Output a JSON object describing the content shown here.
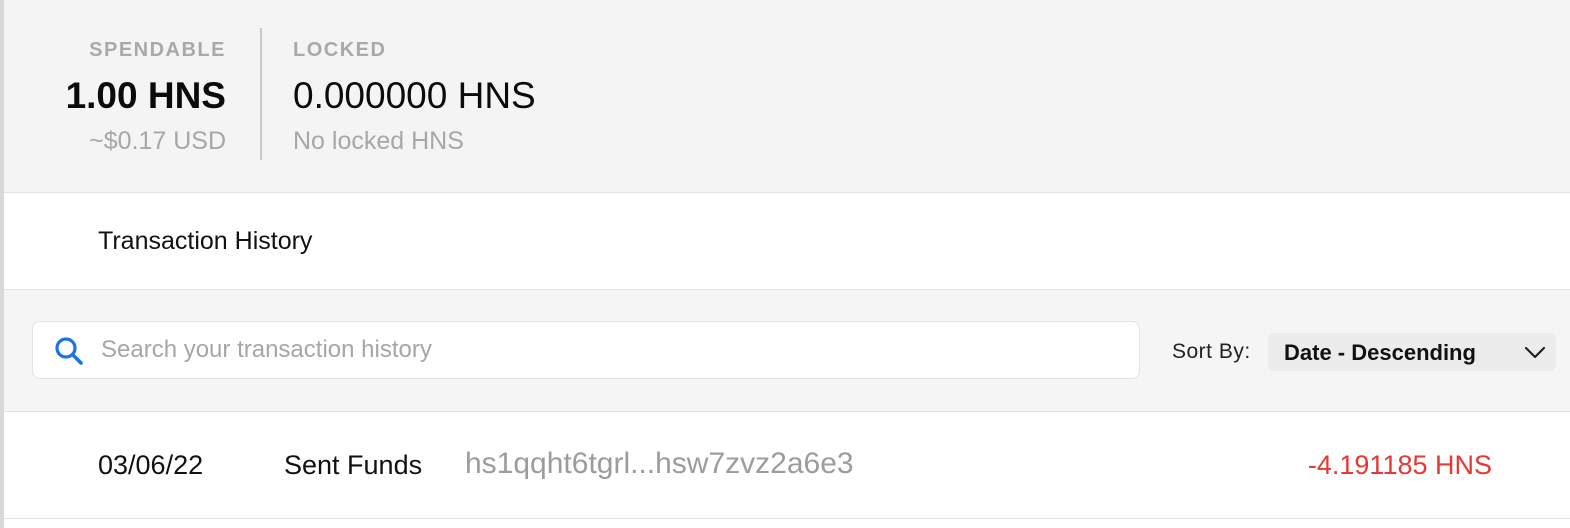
{
  "balances": {
    "spendable": {
      "label": "SPENDABLE",
      "amount": "1.00 HNS",
      "usd": "~$0.17 USD"
    },
    "locked": {
      "label": "LOCKED",
      "amount": "0.000000 HNS",
      "note": "No locked HNS"
    }
  },
  "history": {
    "title": "Transaction History"
  },
  "search": {
    "placeholder": "Search your transaction history",
    "value": "",
    "icon": "search-icon"
  },
  "sort": {
    "label": "Sort By:",
    "selected": "Date - Descending",
    "icon": "chevron-down-icon"
  },
  "transactions": [
    {
      "date": "03/06/22",
      "type": "Sent Funds",
      "address": "hs1qqht6tgrl...hsw7zvz2a6e3",
      "amount": "-4.191185 HNS"
    }
  ],
  "colors": {
    "panel_bg": "#f4f4f4",
    "accent_blue": "#1a73e8",
    "negative_red": "#e53935",
    "muted_text": "#a7a7a7"
  }
}
